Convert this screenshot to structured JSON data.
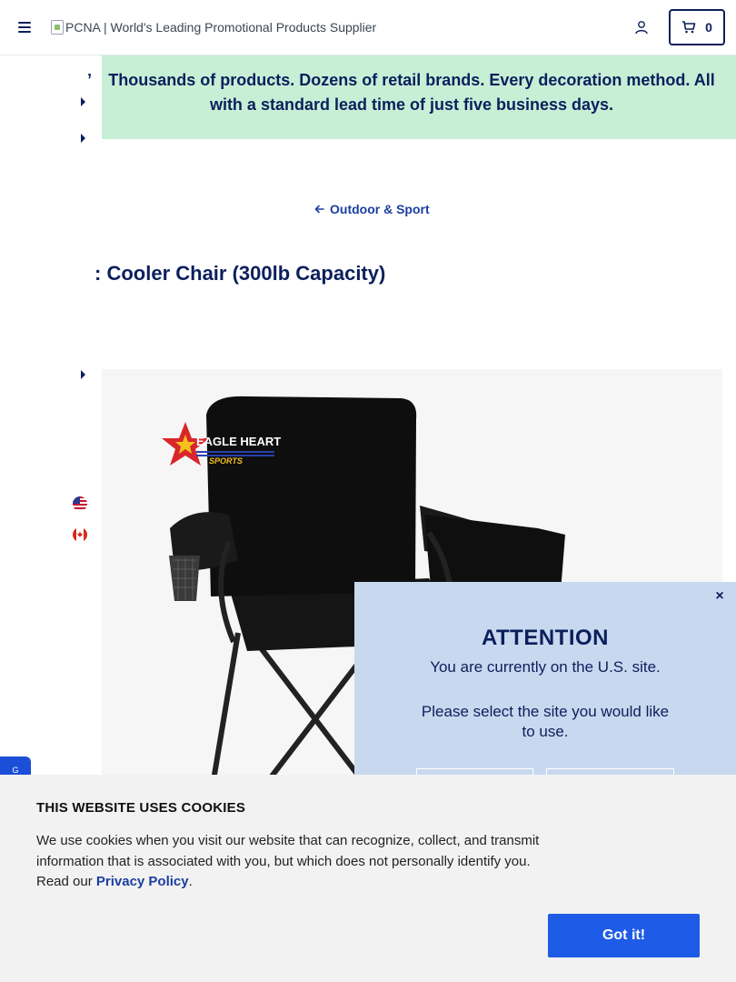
{
  "header": {
    "logo_alt": "PCNA | World's Leading Promotional Products Supplier",
    "cart_count": "0"
  },
  "banner": {
    "text_lead": "’",
    "text": "Thousands of products. Dozens of retail brands. Every decoration method. All with a standard lead time of just five business days."
  },
  "breadcrumb": {
    "label": "Outdoor & Sport"
  },
  "product": {
    "title_prefix": ":",
    "title": "Cooler Chair (300lb Capacity)",
    "logo_brand": "EAGLE HEART",
    "logo_sub": "SPORTS"
  },
  "feedback_tab": {
    "label": "G"
  },
  "site_modal": {
    "title": "ATTENTION",
    "line1": "You are currently on the U.S. site.",
    "line2": "Please select the site you would like to use.",
    "close": "×"
  },
  "cookie_banner": {
    "title": "THIS WEBSITE USES COOKIES",
    "body": "We use cookies when you visit our website that can recognize, collect, and transmit information that is associated with you, but which does not personally identify you. Read our ",
    "link": "Privacy Policy",
    "body_end": ".",
    "button": "Got it!"
  },
  "colors": {
    "navy": "#0b1f5c",
    "banner_green": "#c7efd6",
    "modal_blue": "#c8d8ef",
    "cookie_button": "#1e5be6"
  },
  "icons": [
    "hamburger-menu-icon",
    "account-icon",
    "cart-icon",
    "arrow-left-icon",
    "caret-right-icon",
    "us-flag-icon",
    "canada-flag-icon",
    "close-icon"
  ]
}
